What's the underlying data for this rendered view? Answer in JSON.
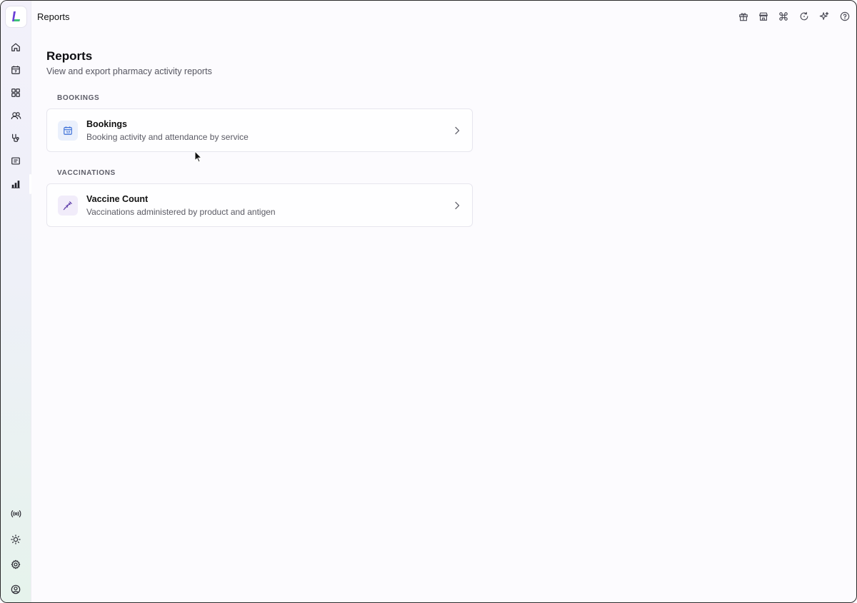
{
  "topbar": {
    "title": "Reports",
    "icons": [
      "gift-icon",
      "store-icon",
      "command-icon",
      "refresh-icon",
      "sparkle-icon",
      "help-icon"
    ]
  },
  "sidebar": {
    "top_items": [
      "home-icon",
      "calendar-icon",
      "grid-icon",
      "users-icon",
      "stethoscope-icon",
      "message-icon",
      "bar-chart-icon"
    ],
    "active_item": "bar-chart-icon",
    "bottom_items": [
      "broadcast-icon",
      "sun-icon",
      "settings-icon",
      "user-circle-icon"
    ]
  },
  "main": {
    "title": "Reports",
    "subtitle": "View and export pharmacy activity reports",
    "sections": [
      {
        "label": "BOOKINGS",
        "card": {
          "title": "Bookings",
          "description": "Booking activity and attendance by service",
          "icon": "calendar-icon",
          "icon_color": "#3b6fd8",
          "icon_bg": "#eaf0fc"
        }
      },
      {
        "label": "VACCINATIONS",
        "card": {
          "title": "Vaccine Count",
          "description": "Vaccinations administered by product and antigen",
          "icon": "syringe-icon",
          "icon_color": "#5b3aa8",
          "icon_bg": "#f1ecfa"
        }
      }
    ]
  },
  "colors": {
    "background": "#fcfbfe",
    "card_border": "#e7e6ee",
    "logo_purple": "#6b3fd6",
    "logo_green": "#3ec27a"
  }
}
